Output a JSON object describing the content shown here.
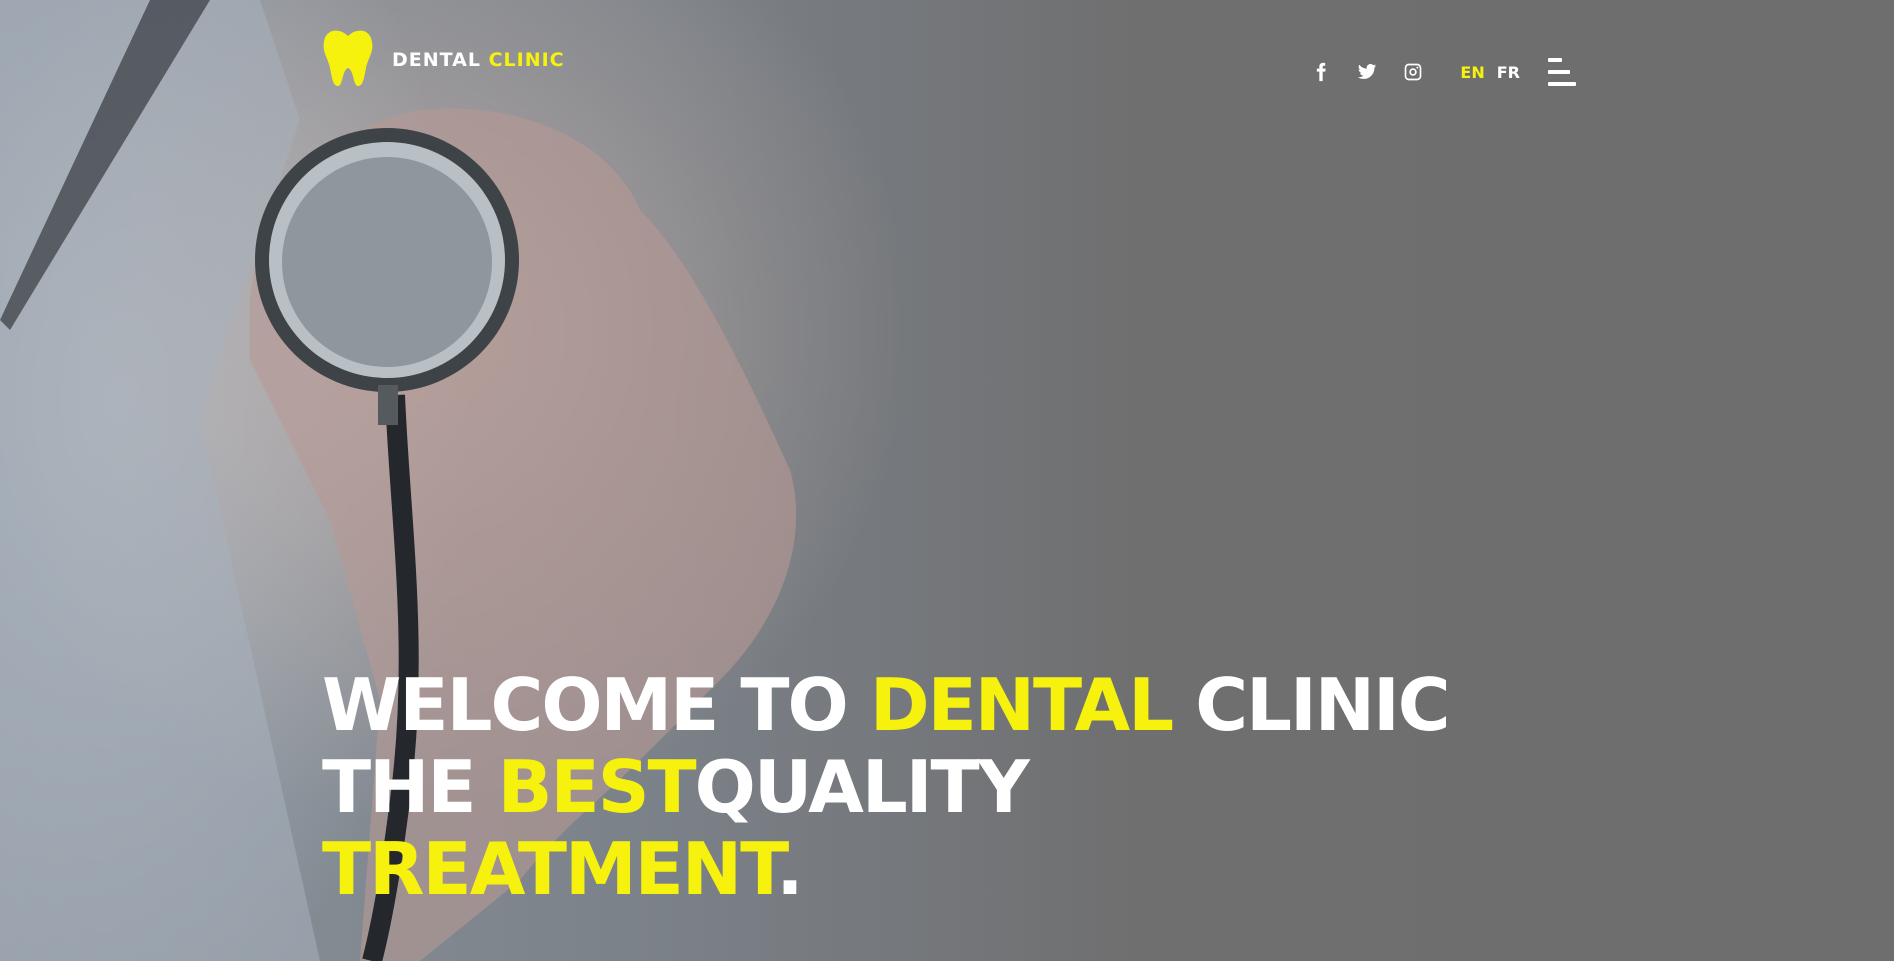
{
  "brand": {
    "word1": "DENTAL",
    "word2": "CLINIC",
    "logo_icon": "tooth-icon"
  },
  "colors": {
    "accent": "#f6f20d",
    "text": "#ffffff",
    "overlay": "#6e6e6e"
  },
  "nav": {
    "social": [
      {
        "icon": "facebook-icon"
      },
      {
        "icon": "twitter-icon"
      },
      {
        "icon": "instagram-icon"
      }
    ],
    "languages": [
      {
        "code": "EN",
        "active": true
      },
      {
        "code": "FR",
        "active": false
      }
    ],
    "menu_icon": "hamburger-menu-icon"
  },
  "hero": {
    "line1": {
      "a": "WELCOME TO ",
      "b": "DENTAL",
      "c": " CLINIC"
    },
    "line2": {
      "a": "THE ",
      "b": "BEST",
      "c": "QUALITY"
    },
    "line3": {
      "a": "TREATMENT",
      "b": "."
    }
  }
}
